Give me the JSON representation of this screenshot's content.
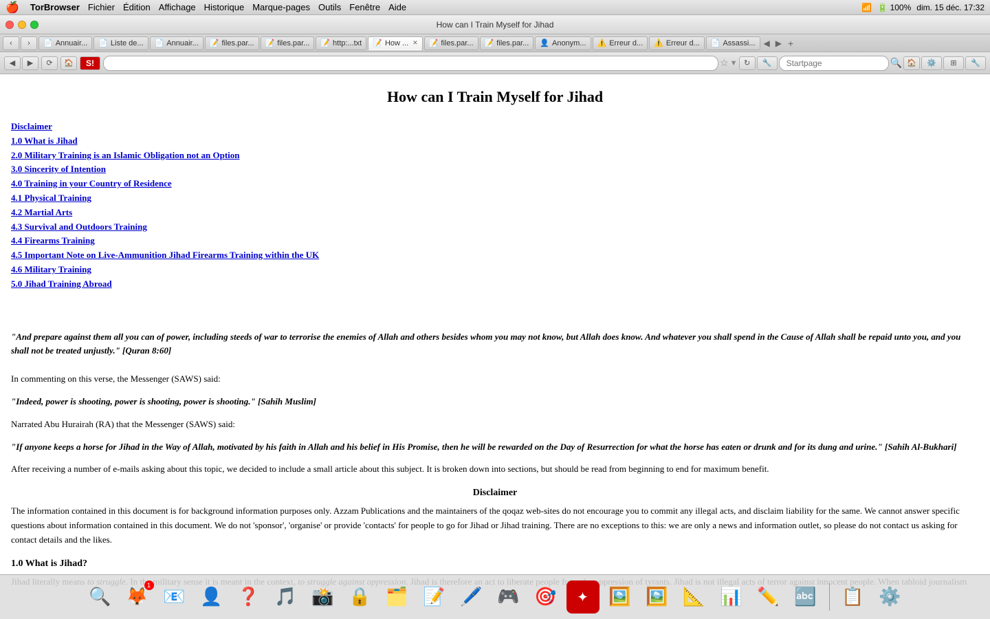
{
  "menubar": {
    "apple": "🍎",
    "items": [
      "TorBrowser",
      "Fichier",
      "Édition",
      "Affichage",
      "Historique",
      "Marque-pages",
      "Outils",
      "Fenêtre",
      "Aide"
    ],
    "right_items": [
      "●",
      "<>",
      "🔋",
      "📶",
      "100%",
      "dim. 15 déc. 17:32"
    ]
  },
  "titlebar": {
    "title": "How can I Train Myself for Jihad",
    "traffic_lights": [
      "red",
      "yellow",
      "green"
    ]
  },
  "tabs": [
    {
      "label": "Annuair...",
      "icon": "📄",
      "active": false
    },
    {
      "label": "Liste de...",
      "icon": "📄",
      "active": false
    },
    {
      "label": "Annuair...",
      "icon": "📄",
      "active": false
    },
    {
      "label": "files.par...",
      "icon": "📝",
      "active": false
    },
    {
      "label": "files.par...",
      "icon": "📝",
      "active": false
    },
    {
      "label": "http:...txt",
      "icon": "📝",
      "active": false
    },
    {
      "label": "How ...",
      "icon": "📝",
      "active": true
    },
    {
      "label": "files.par...",
      "icon": "📝",
      "active": false
    },
    {
      "label": "files.par...",
      "icon": "📝",
      "active": false
    },
    {
      "label": "Anonym...",
      "icon": "👤",
      "active": false
    },
    {
      "label": "Erreur d...",
      "icon": "⚠️",
      "active": false
    },
    {
      "label": "Erreur d...",
      "icon": "⚠️",
      "active": false
    },
    {
      "label": "Assassi...",
      "icon": "📄",
      "active": false
    }
  ],
  "navbar": {
    "url": "",
    "search_placeholder": "Startpage"
  },
  "page": {
    "title": "How can I Train Myself for Jihad",
    "toc": [
      {
        "label": "Disclaimer",
        "href": "#disclaimer"
      },
      {
        "label": "1.0 What is Jihad",
        "href": "#1"
      },
      {
        "label": "2.0 Military Training is an Islamic Obligation not an Option",
        "href": "#2"
      },
      {
        "label": "3.0 Sincerity of Intention",
        "href": "#3"
      },
      {
        "label": "4.0 Training in your Country of Residence",
        "href": "#4"
      },
      {
        "label": "4.1 Physical Training",
        "href": "#4.1"
      },
      {
        "label": "4.2 Martial Arts",
        "href": "#4.2"
      },
      {
        "label": "4.3 Survival and Outdoors Training",
        "href": "#4.3"
      },
      {
        "label": "4.4 Firearms Training",
        "href": "#4.4"
      },
      {
        "label": "4.5 Important Note on Live-Ammunition Jihad Firearms Training within the UK",
        "href": "#4.5"
      },
      {
        "label": "4.6 Military Training",
        "href": "#4.6"
      },
      {
        "label": "5.0 Jihad Training Abroad",
        "href": "#5"
      }
    ],
    "quran_quote": "\"And prepare against them all you can of power, including steeds of war to terrorise the enemies of Allah and others besides whom you may not know, but Allah does know. And whatever you shall spend in the Cause of Allah shall be repaid unto you, and you shall not be treated unjustly.\" [Quran 8:60]",
    "hadith_intro": "In commenting on this verse, the Messenger (SAWS) said:",
    "hadith1": "\"Indeed, power is shooting, power is shooting, power is shooting.\" [Sahih Muslim]",
    "hadith2_intro": "Narrated Abu Hurairah (RA) that the Messenger (SAWS) said:",
    "hadith2": "\"If anyone keeps a horse for Jihad in the Way of Allah, motivated by his faith in Allah and his belief in His Promise, then he will be rewarded on the Day of Resurrection for what the horse has eaten or drunk and for its dung and urine.\" [Sahih Al-Bukhari]",
    "intro_text": "After receiving a number of e-mails asking about this topic, we decided to include a small article about this subject. It is broken down into sections, but should be read from beginning to end for maximum benefit.",
    "disclaimer_heading": "Disclaimer",
    "disclaimer_text": "The information contained in this document is for background information purposes only. Azzam Publications and the maintainers of the qoqaz web-sites do not encourage you to commit any illegal acts, and disclaim liability for the same. We cannot answer specific questions about information contained in this document. We do not 'sponsor', 'organise' or provide 'contacts' for people to go for Jihad or Jihad training. There are no exceptions to this: we are only a news and information outlet, so please do not contact us asking for contact details and the likes.",
    "section1_heading": "1.0 What is Jihad?",
    "section1_text": "Jihad literally means to struggle. In the military sense it is meant in the context, to struggle against oppression. Jihad is therefore an act to liberate people from the oppression of tyrants. Jihad is not illegal acts of terror against innocent people. When tabloid journalism mistakenly informs the masses that Jihad is to commit illegal acts of terror, they are revealing the lack of their research and the extent of their unprofessional approach to"
  },
  "dock": {
    "items": [
      {
        "emoji": "🔍",
        "label": "finder"
      },
      {
        "emoji": "🦊",
        "label": "firefox",
        "badge": "1"
      },
      {
        "emoji": "📧",
        "label": "mail"
      },
      {
        "emoji": "👤",
        "label": "contacts"
      },
      {
        "emoji": "❓",
        "label": "help"
      },
      {
        "emoji": "🎵",
        "label": "itunes"
      },
      {
        "emoji": "📸",
        "label": "photos"
      },
      {
        "emoji": "🔒",
        "label": "security"
      },
      {
        "emoji": "🗂️",
        "label": "files"
      },
      {
        "emoji": "📝",
        "label": "notes"
      },
      {
        "emoji": "🖊️",
        "label": "editor"
      },
      {
        "emoji": "🎮",
        "label": "game"
      },
      {
        "emoji": "🎯",
        "label": "target"
      },
      {
        "emoji": "🔴",
        "label": "red-app"
      },
      {
        "emoji": "🖼️",
        "label": "image"
      },
      {
        "emoji": "🖼️",
        "label": "image2"
      },
      {
        "emoji": "📐",
        "label": "design"
      },
      {
        "emoji": "📊",
        "label": "data"
      },
      {
        "emoji": "✏️",
        "label": "draw"
      },
      {
        "emoji": "🔤",
        "label": "font"
      },
      {
        "emoji": "📋",
        "label": "clipboard"
      },
      {
        "emoji": "⚙️",
        "label": "system"
      }
    ]
  }
}
